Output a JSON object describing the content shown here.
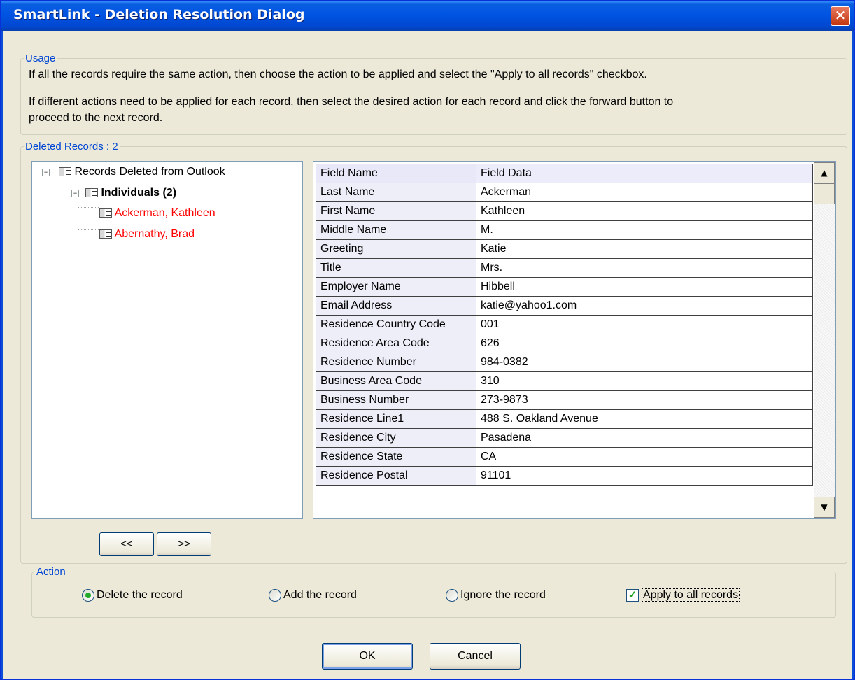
{
  "window": {
    "title": "SmartLink - Deletion Resolution Dialog",
    "close_glyph": "✕"
  },
  "usage": {
    "legend": "Usage",
    "line1": "If all the records require the same action, then choose the action to be applied and select the \"Apply to all records\" checkbox.",
    "line2a": "If different actions need to be applied for each record, then select the desired action for each record and click the forward button to",
    "line2b": "proceed to the next record."
  },
  "deleted": {
    "legend": "Deleted Records : 2"
  },
  "tree": {
    "root_label": "Records Deleted from Outlook",
    "group_label": "Individuals (2)",
    "records": [
      "Ackerman, Kathleen",
      "Abernathy, Brad"
    ],
    "record_color": "#ff0000"
  },
  "grid": {
    "header": [
      "Field Name",
      "Field Data"
    ],
    "rows": [
      [
        "Last Name",
        "Ackerman"
      ],
      [
        "First Name",
        "Kathleen"
      ],
      [
        "Middle Name",
        "M."
      ],
      [
        "Greeting",
        "Katie"
      ],
      [
        "Title",
        "Mrs."
      ],
      [
        "Employer Name",
        "Hibbell"
      ],
      [
        "Email Address",
        "katie@yahoo1.com"
      ],
      [
        "Residence Country Code",
        "001"
      ],
      [
        "Residence Area Code",
        "626"
      ],
      [
        "Residence Number",
        "984-0382"
      ],
      [
        "Business Area Code",
        "310"
      ],
      [
        "Business Number",
        "273-9873"
      ],
      [
        "Residence Line1",
        "488 S. Oakland Avenue"
      ],
      [
        "Residence City",
        "Pasadena"
      ],
      [
        "Residence State",
        "CA"
      ],
      [
        "Residence Postal",
        "91101"
      ]
    ],
    "scroll_up": "▲",
    "scroll_down": "▼"
  },
  "nav": {
    "prev": "<<",
    "next": ">>"
  },
  "action": {
    "legend": "Action",
    "delete": "Delete the record",
    "add": "Add the record",
    "ignore": "Ignore the record",
    "apply_all": "Apply to all records",
    "selected": "delete",
    "apply_all_checked": true,
    "check_glyph": "✓"
  },
  "buttons": {
    "ok": "OK",
    "cancel": "Cancel"
  }
}
